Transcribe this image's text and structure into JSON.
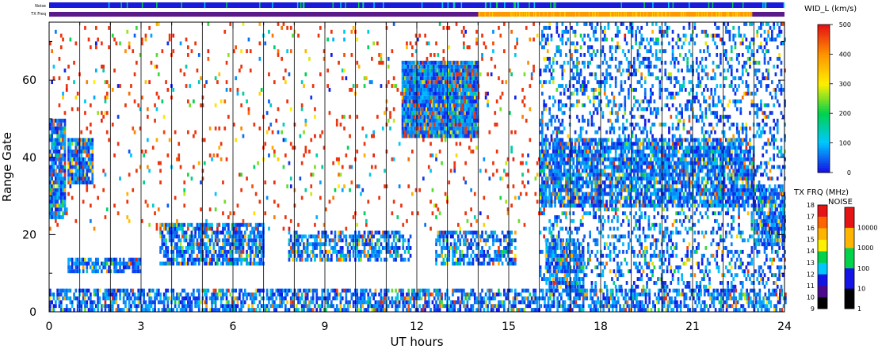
{
  "chart_data": {
    "type": "heatmap",
    "xlabel": "UT hours",
    "ylabel": "Range Gate",
    "xlim": [
      0,
      24
    ],
    "ylim": [
      0,
      75
    ],
    "x_ticks": [
      "0",
      "3",
      "6",
      "9",
      "12",
      "15",
      "18",
      "21",
      "24"
    ],
    "x_tick_values": [
      0,
      3,
      6,
      9,
      12,
      15,
      18,
      21,
      24
    ],
    "y_ticks": [
      "0",
      "20",
      "40",
      "60"
    ],
    "y_tick_values": [
      0,
      20,
      40,
      60
    ],
    "scan_lines_ut": [
      1,
      2,
      3,
      4,
      5,
      6,
      7,
      8,
      9,
      10,
      11,
      12,
      13,
      14,
      15,
      16,
      17,
      18,
      19,
      20,
      21,
      22,
      23
    ],
    "top_strips": {
      "noise_label": "Noise",
      "freq_label": "TX Freq",
      "noise_color": "#1a1adb",
      "freq_color": "#5a1a8a",
      "freq_high_segment_ut": [
        14.0,
        22.95
      ],
      "freq_high_color": "#ff9900"
    },
    "colorbar_width": {
      "title": "WID_L (km/s)",
      "ticks": [
        "0",
        "100",
        "200",
        "300",
        "400",
        "500"
      ],
      "tick_values": [
        0,
        100,
        200,
        300,
        400,
        500
      ],
      "range": [
        0,
        500
      ]
    },
    "colorbar_freq": {
      "title": "TX FRQ (MHz)",
      "ticks": [
        "9",
        "10",
        "11",
        "12",
        "13",
        "14",
        "15",
        "16",
        "17",
        "18"
      ],
      "colors": [
        "#000000",
        "#4b0a8c",
        "#1414e6",
        "#00c8ff",
        "#00d24b",
        "#fff000",
        "#ffb400",
        "#ff6400",
        "#e61414"
      ]
    },
    "colorbar_noise": {
      "title": "NOISE",
      "ticks": [
        "1",
        "10",
        "100",
        "1000",
        "10000"
      ],
      "colors": [
        "#000000",
        "#1414e6",
        "#00d24b",
        "#ffb400",
        "#e61414"
      ]
    },
    "echo_regions": [
      {
        "x": [
          0.0,
          0.5
        ],
        "y": [
          24,
          50
        ],
        "value": 0.15
      },
      {
        "x": [
          0.6,
          1.4
        ],
        "y": [
          33,
          45
        ],
        "value": 0.15
      },
      {
        "x": [
          3.6,
          7.0
        ],
        "y": [
          12,
          23
        ],
        "value": 0.12
      },
      {
        "x": [
          0.6,
          3.0
        ],
        "y": [
          10,
          14
        ],
        "value": 0.12
      },
      {
        "x": [
          7.8,
          11.8
        ],
        "y": [
          13,
          21
        ],
        "value": 0.1
      },
      {
        "x": [
          12.6,
          15.2
        ],
        "y": [
          12,
          21
        ],
        "value": 0.1
      },
      {
        "x": [
          11.5,
          14.0
        ],
        "y": [
          45,
          65
        ],
        "value": 0.3
      },
      {
        "x": [
          16.0,
          23.0
        ],
        "y": [
          27,
          45
        ],
        "value": 0.12
      },
      {
        "x": [
          23.0,
          24.0
        ],
        "y": [
          17,
          33
        ],
        "value": 0.12
      },
      {
        "x": [
          16.2,
          17.4
        ],
        "y": [
          5,
          19
        ],
        "value": 0.12
      },
      {
        "x": [
          0.0,
          24.0
        ],
        "y": [
          0,
          6
        ],
        "value": 0.1
      },
      {
        "x": [
          16.0,
          24.0
        ],
        "y": [
          6,
          75
        ],
        "value": 0.05
      },
      {
        "x": [
          0.0,
          16.0
        ],
        "y": [
          21,
          75
        ],
        "value": 0.01
      }
    ]
  }
}
